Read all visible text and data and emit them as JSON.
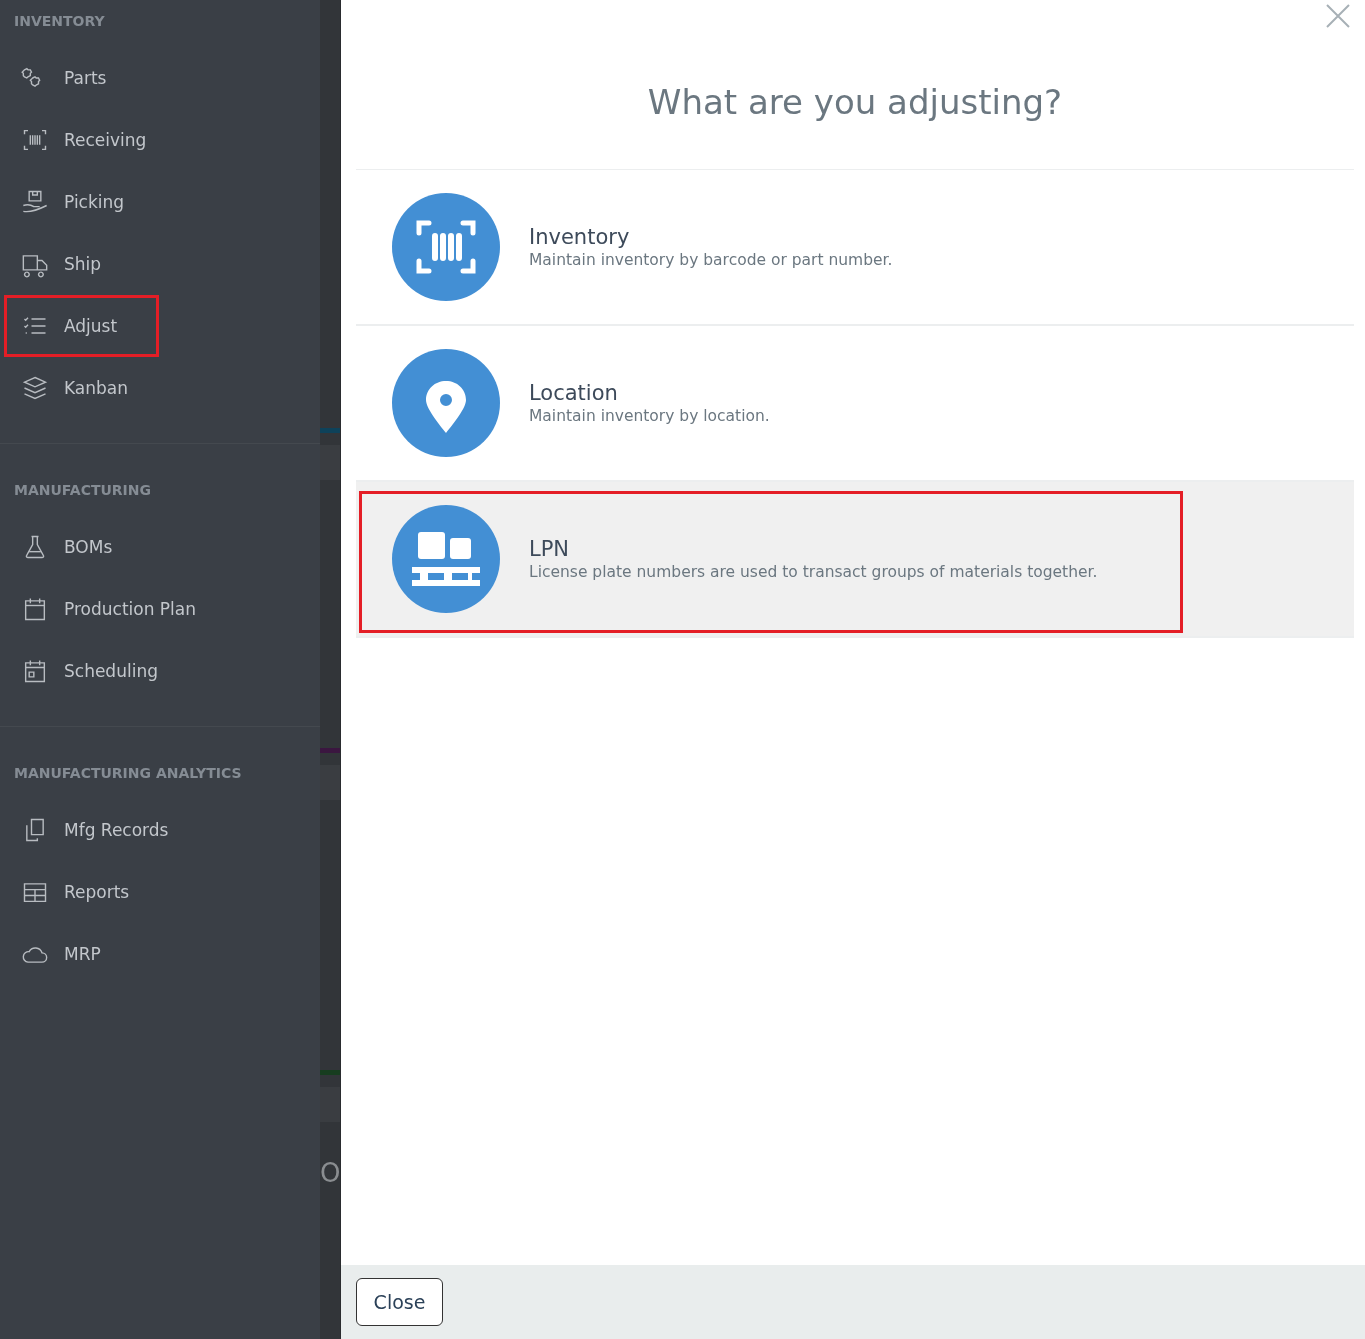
{
  "sidebar": {
    "sections": [
      {
        "heading": "INVENTORY",
        "items": [
          {
            "label": "Parts",
            "highlighted": false
          },
          {
            "label": "Receiving",
            "highlighted": false
          },
          {
            "label": "Picking",
            "highlighted": false
          },
          {
            "label": "Ship",
            "highlighted": false
          },
          {
            "label": "Adjust",
            "highlighted": true
          },
          {
            "label": "Kanban",
            "highlighted": false
          }
        ]
      },
      {
        "heading": "MANUFACTURING",
        "items": [
          {
            "label": "BOMs",
            "highlighted": false
          },
          {
            "label": "Production Plan",
            "highlighted": false
          },
          {
            "label": "Scheduling",
            "highlighted": false
          }
        ]
      },
      {
        "heading": "MANUFACTURING ANALYTICS",
        "items": [
          {
            "label": "Mfg Records",
            "highlighted": false
          },
          {
            "label": "Reports",
            "highlighted": false
          },
          {
            "label": "MRP",
            "highlighted": false
          }
        ]
      }
    ]
  },
  "background_page": {
    "partial_text": "O"
  },
  "dialog": {
    "title": "What are you adjusting?",
    "options": [
      {
        "kind": "barcode",
        "title": "Inventory",
        "description": "Maintain inventory by barcode or part number.",
        "selected": false,
        "highlighted": false
      },
      {
        "kind": "pin",
        "title": "Location",
        "description": "Maintain inventory by location.",
        "selected": false,
        "highlighted": false
      },
      {
        "kind": "pallet",
        "title": "LPN",
        "description": "License plate numbers are used to transact groups of materials together.",
        "selected": true,
        "highlighted": true
      }
    ],
    "close_button": "Close"
  }
}
